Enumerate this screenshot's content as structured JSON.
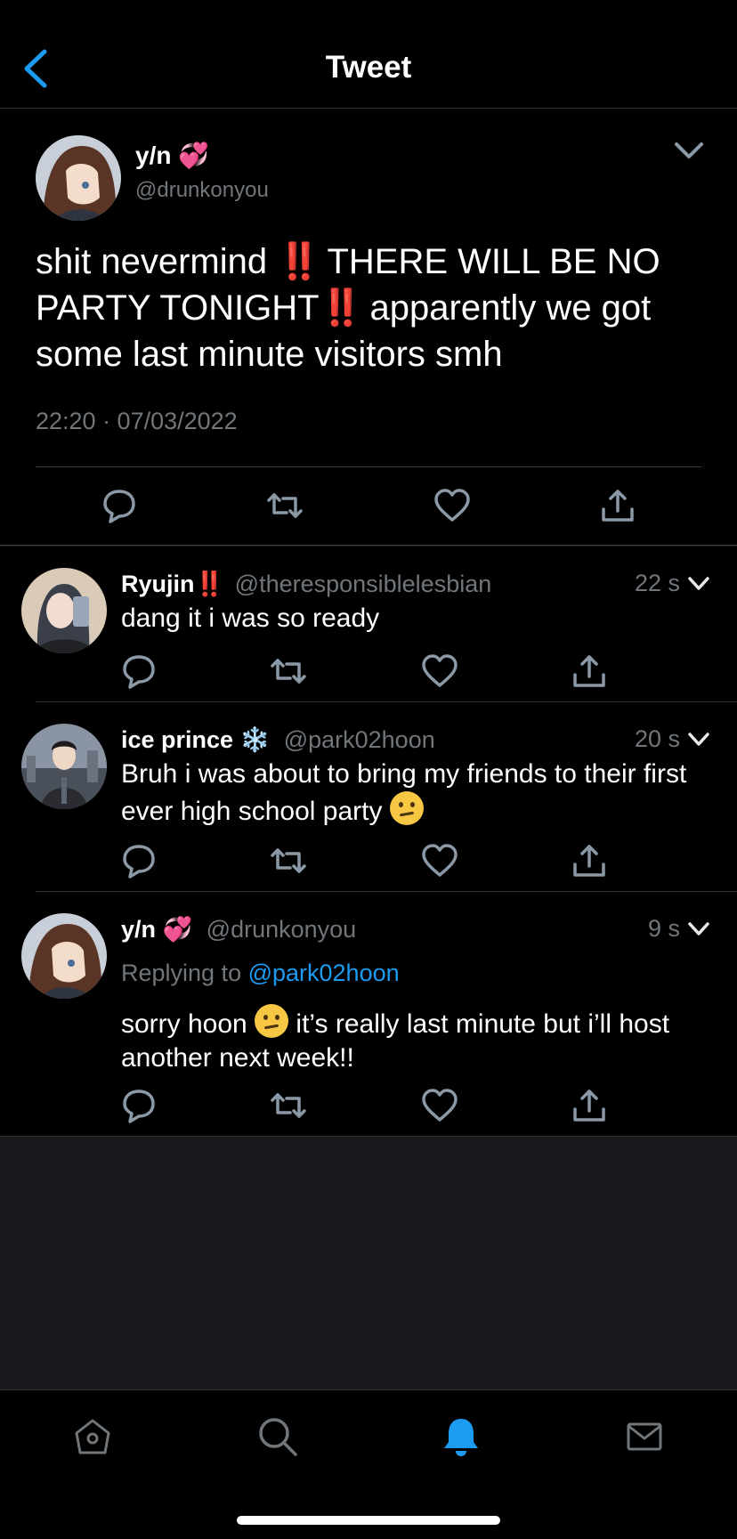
{
  "header": {
    "title": "Tweet"
  },
  "main_tweet": {
    "name": "y/n 💞",
    "handle": "@drunkonyou",
    "text_part1": "shit nevermind ",
    "bang1": "‼️",
    "text_part2": " THERE WILL BE NO PARTY TONIGHT",
    "bang2": "‼️",
    "text_part3": " apparently we got some last minute visitors smh",
    "timestamp": "22:20 · 07/03/2022"
  },
  "replies": [
    {
      "name": "Ryujin",
      "name_suffix": "‼️",
      "handle": "@theresponsiblelesbian",
      "time": "22 s",
      "text": "dang it i was so ready"
    },
    {
      "name": "ice prince ❄️",
      "handle": "@park02hoon",
      "time": "20 s",
      "text": "Bruh i was about to bring my friends to their first ever high school party"
    },
    {
      "name": "y/n 💞",
      "handle": "@drunkonyou",
      "time": "9 s",
      "replying_prefix": "Replying to ",
      "replying_to": "@park02hoon",
      "text_part1": "sorry hoon ",
      "text_part2": " it’s really last minute but i’ll host another next week!!"
    }
  ],
  "tabbar": {
    "items": [
      "home-icon",
      "search-icon",
      "notifications-icon",
      "messages-icon"
    ],
    "active": "notifications-icon",
    "active_color": "#1d9bf0"
  },
  "colors": {
    "accent": "#1d9bf0",
    "muted": "#71767b",
    "background": "#000000"
  }
}
